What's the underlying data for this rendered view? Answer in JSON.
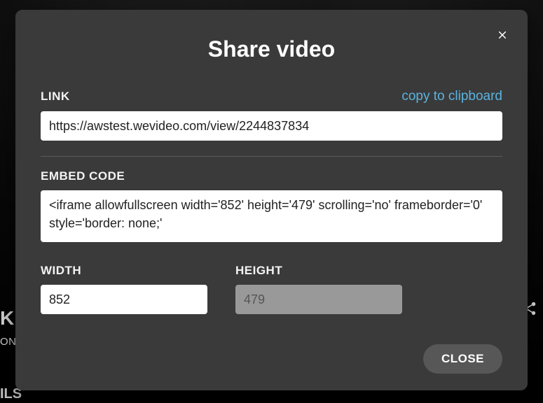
{
  "modal": {
    "title": "Share video",
    "link_label": "LINK",
    "copy_label": "copy to clipboard",
    "link_value": "https://awstest.wevideo.com/view/2244837834",
    "embed_label": "EMBED CODE",
    "embed_value": "<iframe allowfullscreen width='852' height='479' scrolling='no' frameborder='0' style='border: none;'",
    "width_label": "WIDTH",
    "width_value": "852",
    "height_label": "HEIGHT",
    "height_value": "479",
    "close_button": "CLOSE"
  },
  "background": {
    "line1": "K",
    "line2": "ON",
    "line3": "ILS"
  }
}
